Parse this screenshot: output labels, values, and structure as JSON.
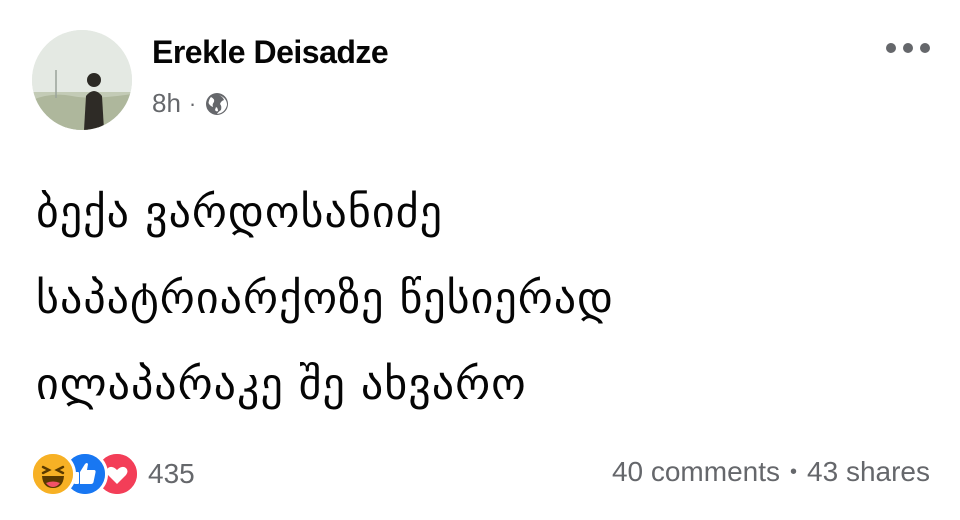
{
  "post": {
    "author": "Erekle Deisadze",
    "time": "8h",
    "separator": "·",
    "privacy_icon": "globe-icon",
    "more_icon": "more-options-icon",
    "text_lines": [
      "ბექა ვარდოსანიძე",
      "საპატრიარქოზე წესიერად",
      "ილაპარაკე შე ახვარო"
    ]
  },
  "reactions": {
    "icons": [
      "haha-icon",
      "like-icon",
      "love-icon"
    ],
    "count": "435"
  },
  "stats": {
    "comments": "40 comments",
    "separator": "•",
    "shares": "43 shares"
  },
  "colors": {
    "text": "#050505",
    "secondary": "#65676b",
    "like": "#1877f2",
    "love": "#f33e58",
    "haha": "#f7b125"
  }
}
